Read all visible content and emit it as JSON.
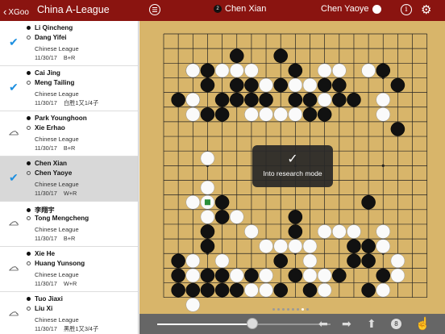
{
  "nav": {
    "back_label": "XGoo",
    "title": "China A-League",
    "black_player": "Chen Xian",
    "black_stone_number": "2",
    "white_player": "Chen Yaoye",
    "info_label": "i"
  },
  "games": [
    {
      "black": "Li Qincheng",
      "white": "Dang Yifei",
      "league": "Chinese League",
      "date": "11/30/17",
      "result": "B+R",
      "status": "check",
      "selected": false
    },
    {
      "black": "Cai Jing",
      "white": "Meng Tailing",
      "league": "Chinese League",
      "date": "11/30/17",
      "result": "白胜1又1/4子",
      "status": "check",
      "selected": false
    },
    {
      "black": "Park Younghoon",
      "white": "Xie Erhao",
      "league": "Chinese League",
      "date": "11/30/17",
      "result": "B+R",
      "status": "cloud",
      "selected": false
    },
    {
      "black": "Chen Xian",
      "white": "Chen Yaoye",
      "league": "Chinese League",
      "date": "11/30/17",
      "result": "W+R",
      "status": "check",
      "selected": true
    },
    {
      "black": "李翔宇",
      "white": "Tong Mengcheng",
      "league": "Chinese League",
      "date": "11/30/17",
      "result": "B+R",
      "status": "cloud",
      "selected": false
    },
    {
      "black": "Xie He",
      "white": "Huang Yunsong",
      "league": "Chinese League",
      "date": "11/30/17",
      "result": "W+R",
      "status": "cloud",
      "selected": false
    },
    {
      "black": "Tuo Jiaxi",
      "white": "Liu Xi",
      "league": "Chinese League",
      "date": "11/30/17",
      "result": "黑胜1又3/4子",
      "status": "cloud",
      "selected": false
    }
  ],
  "board": {
    "size": 19,
    "black": [
      [
        4,
        2
      ],
      [
        7,
        2
      ],
      [
        1,
        3
      ],
      [
        2,
        3
      ],
      [
        8,
        3
      ],
      [
        14,
        3
      ],
      [
        2,
        4
      ],
      [
        4,
        4
      ],
      [
        5,
        4
      ],
      [
        7,
        4
      ],
      [
        10,
        4
      ],
      [
        11,
        4
      ],
      [
        15,
        4
      ],
      [
        0,
        5
      ],
      [
        1,
        5
      ],
      [
        3,
        5
      ],
      [
        4,
        5
      ],
      [
        5,
        5
      ],
      [
        6,
        5
      ],
      [
        8,
        5
      ],
      [
        9,
        5
      ],
      [
        11,
        5
      ],
      [
        12,
        5
      ],
      [
        2,
        6
      ],
      [
        3,
        6
      ],
      [
        9,
        6
      ],
      [
        10,
        6
      ],
      [
        15,
        7
      ],
      [
        3,
        12
      ],
      [
        13,
        12
      ],
      [
        3,
        13
      ],
      [
        8,
        13
      ],
      [
        2,
        14
      ],
      [
        8,
        14
      ],
      [
        2,
        15
      ],
      [
        12,
        15
      ],
      [
        13,
        15
      ],
      [
        0,
        16
      ],
      [
        7,
        16
      ],
      [
        12,
        16
      ],
      [
        13,
        16
      ],
      [
        0,
        17
      ],
      [
        2,
        17
      ],
      [
        3,
        17
      ],
      [
        5,
        17
      ],
      [
        8,
        17
      ],
      [
        11,
        17
      ],
      [
        14,
        17
      ],
      [
        0,
        18
      ],
      [
        1,
        18
      ],
      [
        2,
        18
      ],
      [
        3,
        18
      ],
      [
        4,
        18
      ],
      [
        7,
        18
      ],
      [
        9,
        18
      ],
      [
        13,
        18
      ]
    ],
    "white": [
      [
        1,
        3
      ],
      [
        3,
        3
      ],
      [
        4,
        3
      ],
      [
        5,
        3
      ],
      [
        10,
        3
      ],
      [
        11,
        3
      ],
      [
        13,
        3
      ],
      [
        6,
        4
      ],
      [
        8,
        4
      ],
      [
        9,
        4
      ],
      [
        14,
        5
      ],
      [
        1,
        5
      ],
      [
        10,
        5
      ],
      [
        14,
        6
      ],
      [
        1,
        6
      ],
      [
        5,
        6
      ],
      [
        6,
        6
      ],
      [
        7,
        6
      ],
      [
        8,
        6
      ],
      [
        2,
        9
      ],
      [
        2,
        11
      ],
      [
        1,
        12
      ],
      [
        2,
        12
      ],
      [
        4,
        13
      ],
      [
        2,
        13
      ],
      [
        5,
        14
      ],
      [
        6,
        15
      ],
      [
        9,
        15
      ],
      [
        14,
        14
      ],
      [
        10,
        14
      ],
      [
        11,
        14
      ],
      [
        12,
        14
      ],
      [
        14,
        15
      ],
      [
        15,
        16
      ],
      [
        1,
        16
      ],
      [
        3,
        16
      ],
      [
        7,
        15
      ],
      [
        8,
        15
      ],
      [
        9,
        16
      ],
      [
        1,
        17
      ],
      [
        4,
        17
      ],
      [
        6,
        17
      ],
      [
        9,
        17
      ],
      [
        10,
        17
      ],
      [
        15,
        17
      ],
      [
        5,
        18
      ],
      [
        6,
        18
      ],
      [
        10,
        18
      ],
      [
        14,
        18
      ],
      [
        1,
        19
      ]
    ],
    "last_move": [
      2,
      12
    ]
  },
  "toast": {
    "message": "Into research mode"
  },
  "toolbar": {
    "slider_progress": 0.55,
    "move_number": "8",
    "page_count": 8,
    "page_active": 6
  }
}
